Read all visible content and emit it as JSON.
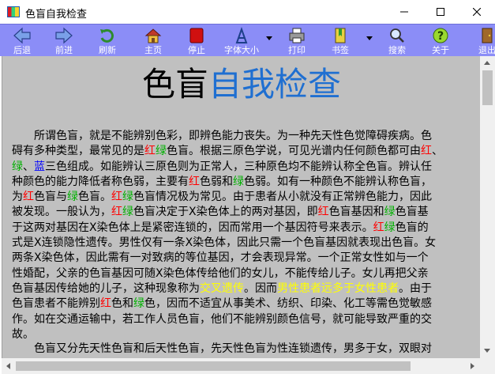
{
  "window": {
    "title": "色盲自我检查"
  },
  "toolbar": {
    "buttons": [
      {
        "label": "后退",
        "icon": "back-arrow-icon"
      },
      {
        "label": "前进",
        "icon": "forward-arrow-icon"
      },
      {
        "label": "刷新",
        "icon": "refresh-icon"
      },
      {
        "label": "主页",
        "icon": "home-icon"
      },
      {
        "label": "停止",
        "icon": "stop-icon"
      },
      {
        "label": "字体大小",
        "icon": "font-size-icon"
      },
      {
        "label": "打印",
        "icon": "print-icon"
      },
      {
        "label": "书签",
        "icon": "bookmark-icon"
      },
      {
        "label": "搜索",
        "icon": "search-icon"
      },
      {
        "label": "关于",
        "icon": "help-icon"
      },
      {
        "label": "退出",
        "icon": "exit-icon"
      }
    ]
  },
  "page": {
    "heading_part1": "色盲",
    "heading_part2": "自我检查",
    "paragraph1": [
      "　　所谓色盲，就是不能辨别色彩，即辨色能力丧失。为一种先天性色觉障碍疾病。色",
      "碍有多种类型，最常见的是红绿色盲。根据三原色学说，可见光谱内任何颜色都可由红、",
      "绿、蓝三色组成。如能辨认三原色则为正常人，三种原色均不能辨认称全色盲。辨认任",
      "种颜色的能力降低者称色弱，主要有红色弱和绿色弱。如有一种颜色不能辨认称色盲，",
      "为红色盲与绿色盲。红绿色盲情况极为常见。由于患者从小就没有正常辨色能力，因此",
      "被发现。一般认为，红绿色盲决定于X染色体上的两对基因，即红色盲基因和绿色盲基",
      "于这两对基因在X染色体上是紧密连锁的，因而常用一个基因符号来表示。红绿色盲的",
      "式是X连锁隐性遗传。男性仅有一条X染色体，因此只需一个色盲基因就表现出色盲。女",
      "两条X染色体，因此需有一对致病的等位基因，才会表现异常。一个正常女性如与一个",
      "性婚配，父亲的色盲基因可随X染色体传给他们的女儿，不能传给儿子。女儿再把父亲",
      "色盲基因传给她的儿子，这种现象称为交叉遗传。因而男性患者远多于女性患者。由于",
      "色盲患者不能辨别红色和绿色，因而不适宜从事美术、纺织、印染、化工等需色觉敏感",
      "作。如在交通运输中，若工作人员色盲，他们不能辨别颜色信号，就可能导致严重的交",
      "故。"
    ],
    "paragraph2": [
      "　　色盲又分先天性色盲和后天性色盲，先天性色盲为性连锁遗传，男多于女，双眼对"
    ],
    "colors": {
      "red": "#ff0000",
      "green": "#00b000",
      "blue": "#0000ff",
      "yellow": "#ffff00",
      "heading_blue": "#1f6fd1",
      "toolbar": "#8b8df7",
      "content_bg": "#c0c0c0"
    }
  }
}
